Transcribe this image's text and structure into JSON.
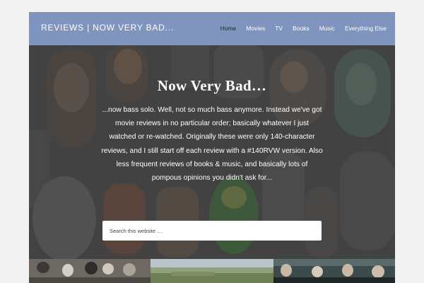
{
  "site": {
    "title": "REVIEWS | NOW VERY BAD..."
  },
  "nav": {
    "items": [
      {
        "label": "Home",
        "current": true
      },
      {
        "label": "Movies",
        "current": false
      },
      {
        "label": "TV",
        "current": false
      },
      {
        "label": "Books",
        "current": false
      },
      {
        "label": "Music",
        "current": false
      },
      {
        "label": "Everything Else",
        "current": false
      }
    ]
  },
  "hero": {
    "title": "Now Very Bad…",
    "description": "...now bass solo. Well, not so much bass anymore. Instead we've got movie reviews in no particular order; basically whatever I just watched or re-watched. Originally these were only 140-character reviews, and I still start off each review with a #140RVW version. Also less frequent reviews of books & music, and basically lots of pompous opinions you didn't ask for..."
  },
  "search": {
    "placeholder": "Search this website …",
    "value": ""
  },
  "colors": {
    "header": "#7f95bd",
    "page_background": "#f2f2f2",
    "hero_overlay": "#3c3c3c"
  }
}
